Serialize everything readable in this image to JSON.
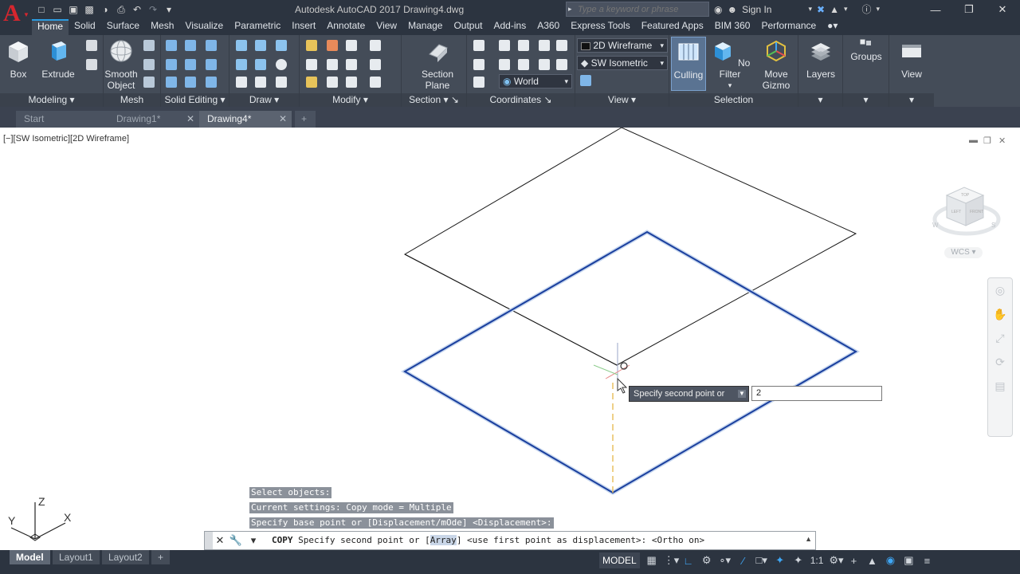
{
  "app": {
    "title": "Autodesk AutoCAD 2017    Drawing4.dwg",
    "logo_letter": "A",
    "search_placeholder": "Type a keyword or phrase",
    "sign_in": "Sign In"
  },
  "ribbon_tabs": [
    "Home",
    "Solid",
    "Surface",
    "Mesh",
    "Visualize",
    "Parametric",
    "Insert",
    "Annotate",
    "View",
    "Manage",
    "Output",
    "Add-ins",
    "A360",
    "Express Tools",
    "Featured Apps",
    "BIM 360",
    "Performance"
  ],
  "ribbon": {
    "box": "Box",
    "extrude": "Extrude",
    "smooth_object": "Smooth\nObject",
    "section_plane": "Section\nPlane",
    "visual_style": "2D Wireframe",
    "view_preset": "SW Isometric",
    "ucs": "World",
    "culling": "Culling",
    "no_filter": "No Filter",
    "move_gizmo": "Move\nGizmo",
    "layers": "Layers",
    "groups": "Groups",
    "view": "View",
    "panels": {
      "modeling": "Modeling",
      "mesh": "Mesh",
      "solid_editing": "Solid Editing",
      "draw": "Draw",
      "modify": "Modify",
      "section": "Section",
      "coordinates": "Coordinates",
      "view": "View",
      "selection": "Selection"
    }
  },
  "doc_tabs": [
    {
      "label": "Start"
    },
    {
      "label": "Drawing1*"
    },
    {
      "label": "Drawing4*"
    }
  ],
  "viewport": {
    "label": "[−][SW Isometric][2D Wireframe]",
    "dyn_prompt": "Specify second point or",
    "dyn_input": "2",
    "wcs": "WCS"
  },
  "history": [
    "Select objects:",
    "Current settings:  Copy mode = Multiple",
    "Specify base point or [Displacement/mOde] <Displacement>:"
  ],
  "command": {
    "name": "COPY",
    "prefix": " Specify second point or [",
    "keyword": "Array",
    "suffix": "] <use first point as displacement>:  <Ortho on>"
  },
  "ucs_icon": {
    "x": "X",
    "y": "Y",
    "z": "Z"
  },
  "layout_tabs": [
    "Model",
    "Layout1",
    "Layout2"
  ],
  "status": {
    "model": "MODEL",
    "scale": "1:1"
  }
}
